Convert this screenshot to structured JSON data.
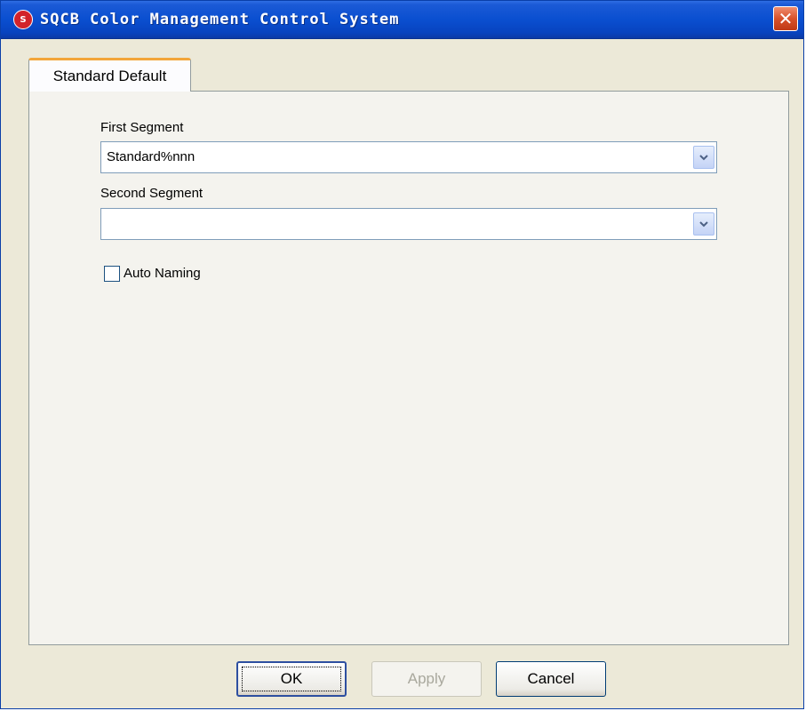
{
  "window": {
    "title": "SQCB Color Management Control System",
    "icon": "app-logo-icon",
    "icon_text": "S",
    "close_glyph": "✕"
  },
  "tabs": [
    {
      "label": "Standard Default",
      "selected": true
    }
  ],
  "form": {
    "first_segment": {
      "label": "First Segment",
      "value": "Standard%nnn"
    },
    "second_segment": {
      "label": "Second Segment",
      "value": ""
    },
    "auto_naming": {
      "label": "Auto Naming",
      "checked": false
    }
  },
  "buttons": {
    "ok": "OK",
    "apply": "Apply",
    "cancel": "Cancel"
  },
  "colors": {
    "titlebar": "#0a4fd0",
    "tab_accent": "#f3a63a",
    "dialog_bg": "#ece9d8"
  }
}
